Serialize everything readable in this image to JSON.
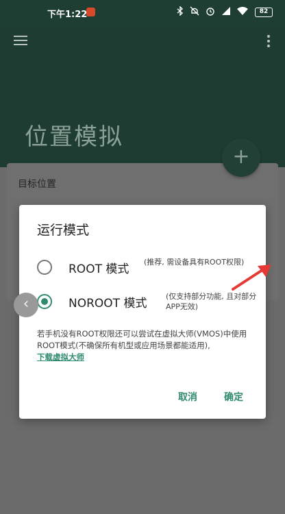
{
  "status_bar": {
    "time": "下午1:22",
    "battery": "82",
    "icons": [
      "bluetooth-icon",
      "mute-icon",
      "alarm-icon",
      "signal-icon",
      "wifi-icon"
    ]
  },
  "header": {
    "title": "位置模拟",
    "fab_label": "+"
  },
  "card": {
    "label": "目标位置"
  },
  "dialog": {
    "title": "运行模式",
    "options": [
      {
        "label": "ROOT 模式",
        "description": "(推荐, 需设备具有ROOT权限)",
        "selected": false
      },
      {
        "label": "NOROOT 模式",
        "description": "(仅支持部分功能, 且对部分APP无效)",
        "selected": true
      }
    ],
    "note": "若手机没有ROOT权限还可以尝试在虚拟大师(VMOS)中使用ROOT模式(不确保所有机型或应用场景都能适用),",
    "download_link": "下载虚拟大师",
    "cancel_label": "取消",
    "ok_label": "确定"
  },
  "colors": {
    "accent": "#2f8a70",
    "annotation_arrow": "#e53935"
  }
}
